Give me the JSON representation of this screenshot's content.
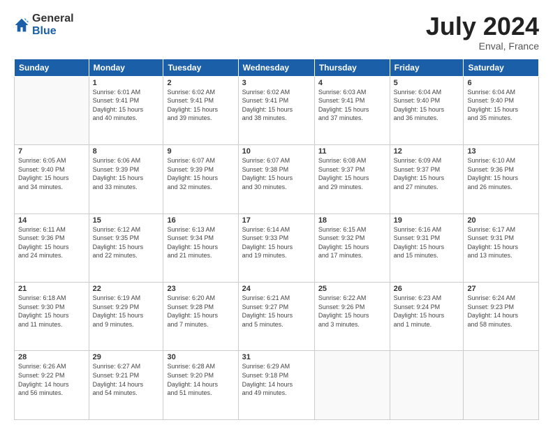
{
  "logo": {
    "general": "General",
    "blue": "Blue"
  },
  "title": "July 2024",
  "subtitle": "Enval, France",
  "headers": [
    "Sunday",
    "Monday",
    "Tuesday",
    "Wednesday",
    "Thursday",
    "Friday",
    "Saturday"
  ],
  "weeks": [
    [
      {
        "day": "",
        "info": ""
      },
      {
        "day": "1",
        "info": "Sunrise: 6:01 AM\nSunset: 9:41 PM\nDaylight: 15 hours\nand 40 minutes."
      },
      {
        "day": "2",
        "info": "Sunrise: 6:02 AM\nSunset: 9:41 PM\nDaylight: 15 hours\nand 39 minutes."
      },
      {
        "day": "3",
        "info": "Sunrise: 6:02 AM\nSunset: 9:41 PM\nDaylight: 15 hours\nand 38 minutes."
      },
      {
        "day": "4",
        "info": "Sunrise: 6:03 AM\nSunset: 9:41 PM\nDaylight: 15 hours\nand 37 minutes."
      },
      {
        "day": "5",
        "info": "Sunrise: 6:04 AM\nSunset: 9:40 PM\nDaylight: 15 hours\nand 36 minutes."
      },
      {
        "day": "6",
        "info": "Sunrise: 6:04 AM\nSunset: 9:40 PM\nDaylight: 15 hours\nand 35 minutes."
      }
    ],
    [
      {
        "day": "7",
        "info": "Sunrise: 6:05 AM\nSunset: 9:40 PM\nDaylight: 15 hours\nand 34 minutes."
      },
      {
        "day": "8",
        "info": "Sunrise: 6:06 AM\nSunset: 9:39 PM\nDaylight: 15 hours\nand 33 minutes."
      },
      {
        "day": "9",
        "info": "Sunrise: 6:07 AM\nSunset: 9:39 PM\nDaylight: 15 hours\nand 32 minutes."
      },
      {
        "day": "10",
        "info": "Sunrise: 6:07 AM\nSunset: 9:38 PM\nDaylight: 15 hours\nand 30 minutes."
      },
      {
        "day": "11",
        "info": "Sunrise: 6:08 AM\nSunset: 9:37 PM\nDaylight: 15 hours\nand 29 minutes."
      },
      {
        "day": "12",
        "info": "Sunrise: 6:09 AM\nSunset: 9:37 PM\nDaylight: 15 hours\nand 27 minutes."
      },
      {
        "day": "13",
        "info": "Sunrise: 6:10 AM\nSunset: 9:36 PM\nDaylight: 15 hours\nand 26 minutes."
      }
    ],
    [
      {
        "day": "14",
        "info": "Sunrise: 6:11 AM\nSunset: 9:36 PM\nDaylight: 15 hours\nand 24 minutes."
      },
      {
        "day": "15",
        "info": "Sunrise: 6:12 AM\nSunset: 9:35 PM\nDaylight: 15 hours\nand 22 minutes."
      },
      {
        "day": "16",
        "info": "Sunrise: 6:13 AM\nSunset: 9:34 PM\nDaylight: 15 hours\nand 21 minutes."
      },
      {
        "day": "17",
        "info": "Sunrise: 6:14 AM\nSunset: 9:33 PM\nDaylight: 15 hours\nand 19 minutes."
      },
      {
        "day": "18",
        "info": "Sunrise: 6:15 AM\nSunset: 9:32 PM\nDaylight: 15 hours\nand 17 minutes."
      },
      {
        "day": "19",
        "info": "Sunrise: 6:16 AM\nSunset: 9:31 PM\nDaylight: 15 hours\nand 15 minutes."
      },
      {
        "day": "20",
        "info": "Sunrise: 6:17 AM\nSunset: 9:31 PM\nDaylight: 15 hours\nand 13 minutes."
      }
    ],
    [
      {
        "day": "21",
        "info": "Sunrise: 6:18 AM\nSunset: 9:30 PM\nDaylight: 15 hours\nand 11 minutes."
      },
      {
        "day": "22",
        "info": "Sunrise: 6:19 AM\nSunset: 9:29 PM\nDaylight: 15 hours\nand 9 minutes."
      },
      {
        "day": "23",
        "info": "Sunrise: 6:20 AM\nSunset: 9:28 PM\nDaylight: 15 hours\nand 7 minutes."
      },
      {
        "day": "24",
        "info": "Sunrise: 6:21 AM\nSunset: 9:27 PM\nDaylight: 15 hours\nand 5 minutes."
      },
      {
        "day": "25",
        "info": "Sunrise: 6:22 AM\nSunset: 9:26 PM\nDaylight: 15 hours\nand 3 minutes."
      },
      {
        "day": "26",
        "info": "Sunrise: 6:23 AM\nSunset: 9:24 PM\nDaylight: 15 hours\nand 1 minute."
      },
      {
        "day": "27",
        "info": "Sunrise: 6:24 AM\nSunset: 9:23 PM\nDaylight: 14 hours\nand 58 minutes."
      }
    ],
    [
      {
        "day": "28",
        "info": "Sunrise: 6:26 AM\nSunset: 9:22 PM\nDaylight: 14 hours\nand 56 minutes."
      },
      {
        "day": "29",
        "info": "Sunrise: 6:27 AM\nSunset: 9:21 PM\nDaylight: 14 hours\nand 54 minutes."
      },
      {
        "day": "30",
        "info": "Sunrise: 6:28 AM\nSunset: 9:20 PM\nDaylight: 14 hours\nand 51 minutes."
      },
      {
        "day": "31",
        "info": "Sunrise: 6:29 AM\nSunset: 9:18 PM\nDaylight: 14 hours\nand 49 minutes."
      },
      {
        "day": "",
        "info": ""
      },
      {
        "day": "",
        "info": ""
      },
      {
        "day": "",
        "info": ""
      }
    ]
  ]
}
